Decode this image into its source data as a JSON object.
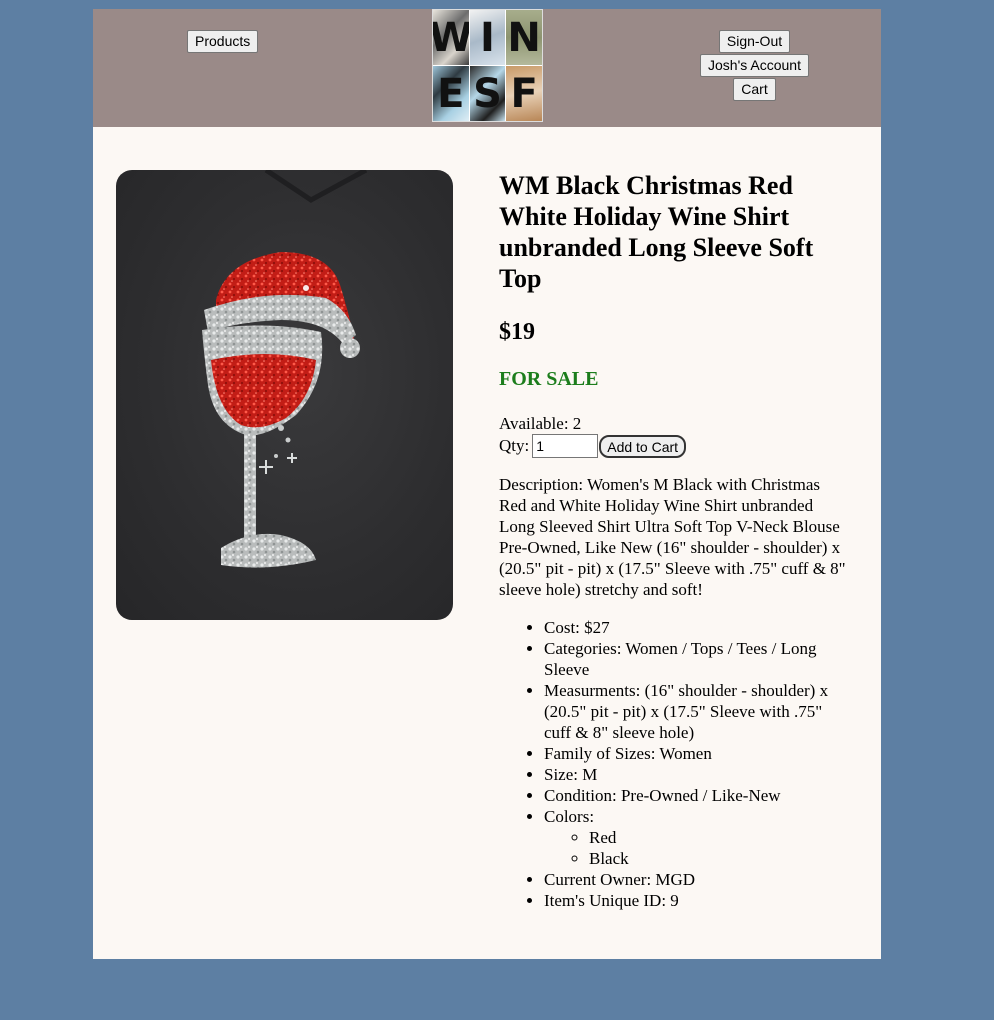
{
  "header": {
    "products_label": "Products",
    "logo_letters": [
      "W",
      "I",
      "N",
      "E",
      "S",
      "F"
    ],
    "signout_label": "Sign-Out",
    "account_label": "Josh's Account",
    "cart_label": "Cart"
  },
  "product": {
    "title": "WM Black Christmas Red White Holiday Wine Shirt unbranded Long Sleeve Soft Top",
    "price": "$19",
    "status": "FOR SALE",
    "available_text": "Available: 2",
    "qty_label": "Qty:",
    "qty_value": "1",
    "add_to_cart_label": "Add to Cart",
    "description": "Description: Women's M Black with Christmas Red and White Holiday Wine Shirt unbranded Long Sleeved Shirt Ultra Soft Top V-Neck Blouse Pre-Owned, Like New (16\" shoulder - shoulder) x (20.5\" pit - pit) x (17.5\" Sleeve with .75\" cuff & 8\" sleeve hole) stretchy and soft!",
    "details": {
      "cost": "Cost: $27",
      "categories": "Categories: Women / Tops / Tees / Long Sleeve",
      "measurements": "Measurments: (16\" shoulder - shoulder) x (20.5\" pit - pit) x (17.5\" Sleeve with .75\" cuff & 8\" sleeve hole)",
      "family": "Family of Sizes: Women",
      "size": "Size: M",
      "condition": "Condition: Pre-Owned / Like-New",
      "colors_label": "Colors:",
      "colors": [
        "Red",
        "Black"
      ],
      "owner": "Current Owner: MGD",
      "unique_id": "Item's Unique ID: 9"
    }
  },
  "colors": {
    "background": "#5d7fa3",
    "header": "#9a8a88",
    "page": "#fcf8f4",
    "sale_green": "#1c7d1c"
  }
}
